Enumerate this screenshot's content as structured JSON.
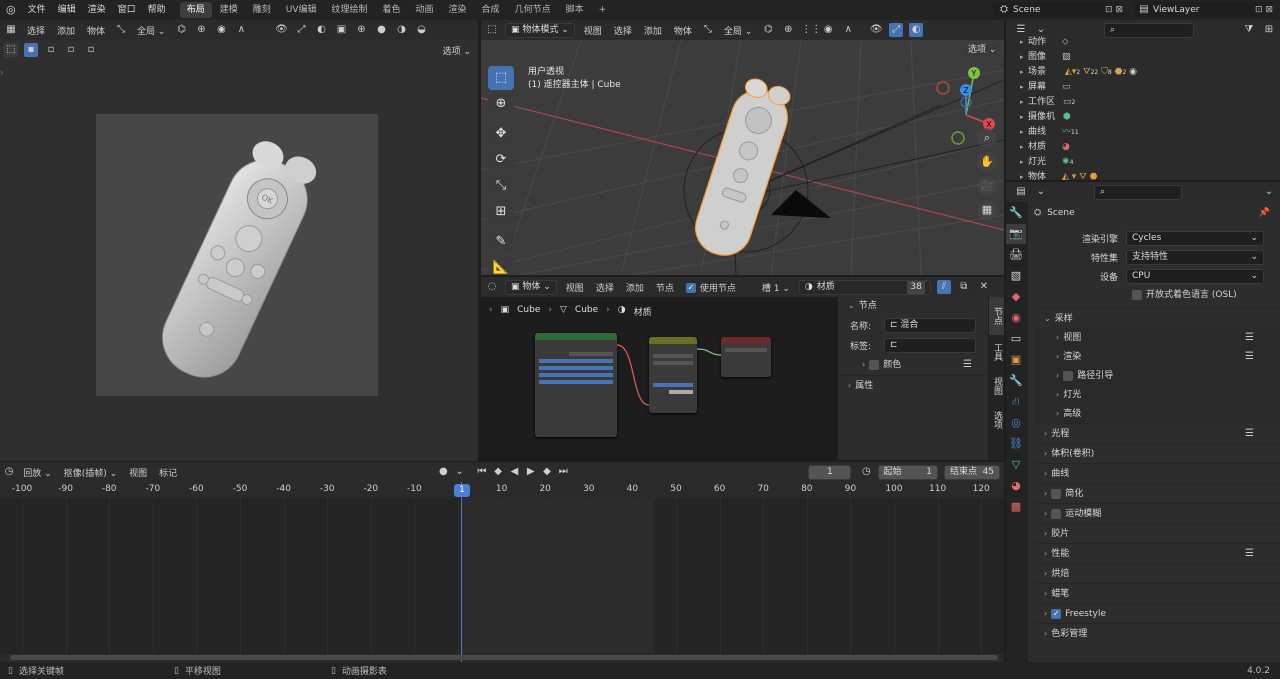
{
  "topbar": {
    "menus": [
      "文件",
      "编辑",
      "渲染",
      "窗口",
      "帮助"
    ],
    "workspaces": [
      "布局",
      "建模",
      "雕刻",
      "UV编辑",
      "纹理绘制",
      "着色",
      "动画",
      "渲染",
      "合成",
      "几何节点",
      "脚本"
    ],
    "active_workspace": "布局",
    "scene": "Scene",
    "view_layer": "ViewLayer"
  },
  "image_editor": {
    "menus": [
      "选择",
      "添加",
      "物体"
    ],
    "transform_orientation": "全局",
    "options_label": "选项"
  },
  "viewport": {
    "mode": "物体模式",
    "menus": [
      "视图",
      "选择",
      "添加",
      "物体"
    ],
    "orientation": "全局",
    "options_label": "选项",
    "overlay_title": "用户透视",
    "overlay_subtitle": "(1) 遥控器主体 | Cube"
  },
  "node_editor": {
    "type_label": "物体",
    "menus": [
      "视图",
      "选择",
      "添加",
      "节点"
    ],
    "use_nodes_label": "使用节点",
    "slot": "槽 1",
    "material_name": "材质",
    "user_count": "38",
    "breadcrumb": [
      "Cube",
      "Cube",
      "材质"
    ],
    "sidebar": {
      "panel_title": "节点",
      "name_label": "名称:",
      "name_value": "混合",
      "label_label": "标签:",
      "label_value": "",
      "color_label": "颜色",
      "props_label": "属性",
      "tabs": [
        "节点",
        "工具",
        "视图",
        "选项"
      ]
    }
  },
  "timeline": {
    "menus": [
      "回放",
      "抠像(插帧)",
      "视图",
      "标记"
    ],
    "current_frame": "1",
    "start_label": "起始",
    "start_value": "1",
    "end_label": "结束点",
    "end_value": "45",
    "ruler": [
      "-100",
      "-90",
      "-80",
      "-70",
      "-60",
      "-50",
      "-40",
      "-30",
      "-20",
      "-10",
      "1",
      "10",
      "20",
      "30",
      "40",
      "50",
      "60",
      "70",
      "80",
      "90",
      "100",
      "110",
      "120"
    ]
  },
  "outliner": {
    "rows": [
      "动作",
      "图像",
      "场景",
      "屏幕",
      "工作区",
      "摄像机",
      "曲线",
      "材质",
      "灯光",
      "物体"
    ],
    "badges": [
      "2",
      "22",
      "8",
      "2",
      "2",
      "11",
      "4"
    ]
  },
  "properties": {
    "scene_name": "Scene",
    "render_engine_label": "渲染引擎",
    "render_engine": "Cycles",
    "feature_set_label": "特性集",
    "feature_set": "支持特性",
    "device_label": "设备",
    "device": "CPU",
    "osl_label": "开放式着色语言 (OSL)",
    "sections": [
      {
        "label": "采样",
        "level": 0,
        "open": true
      },
      {
        "label": "视图",
        "level": 1
      },
      {
        "label": "渲染",
        "level": 1
      },
      {
        "label": "路径引导",
        "level": 1,
        "check": true
      },
      {
        "label": "灯光",
        "level": 1
      },
      {
        "label": "高级",
        "level": 1
      },
      {
        "label": "光程",
        "level": 0
      },
      {
        "label": "体积(卷积)",
        "level": 0
      },
      {
        "label": "曲线",
        "level": 0
      },
      {
        "label": "简化",
        "level": 0,
        "check": true
      },
      {
        "label": "运动模糊",
        "level": 0,
        "check": true
      },
      {
        "label": "胶片",
        "level": 0
      },
      {
        "label": "性能",
        "level": 0
      },
      {
        "label": "烘焙",
        "level": 0
      },
      {
        "label": "蜡笔",
        "level": 0
      },
      {
        "label": "Freestyle",
        "level": 0,
        "check": true,
        "checked": true
      },
      {
        "label": "色彩管理",
        "level": 0
      }
    ]
  },
  "status_bar": {
    "select_keyframe": "选择关键帧",
    "pan_view": "平移视图",
    "anim_menu": "动画摄影表",
    "version": "4.0.2"
  },
  "colors": {
    "accent": "#4772b3",
    "playhead": "#4a7fd6",
    "axis_x": "#e0484f",
    "axis_y": "#7fc242",
    "axis_z": "#3b8ee6"
  }
}
